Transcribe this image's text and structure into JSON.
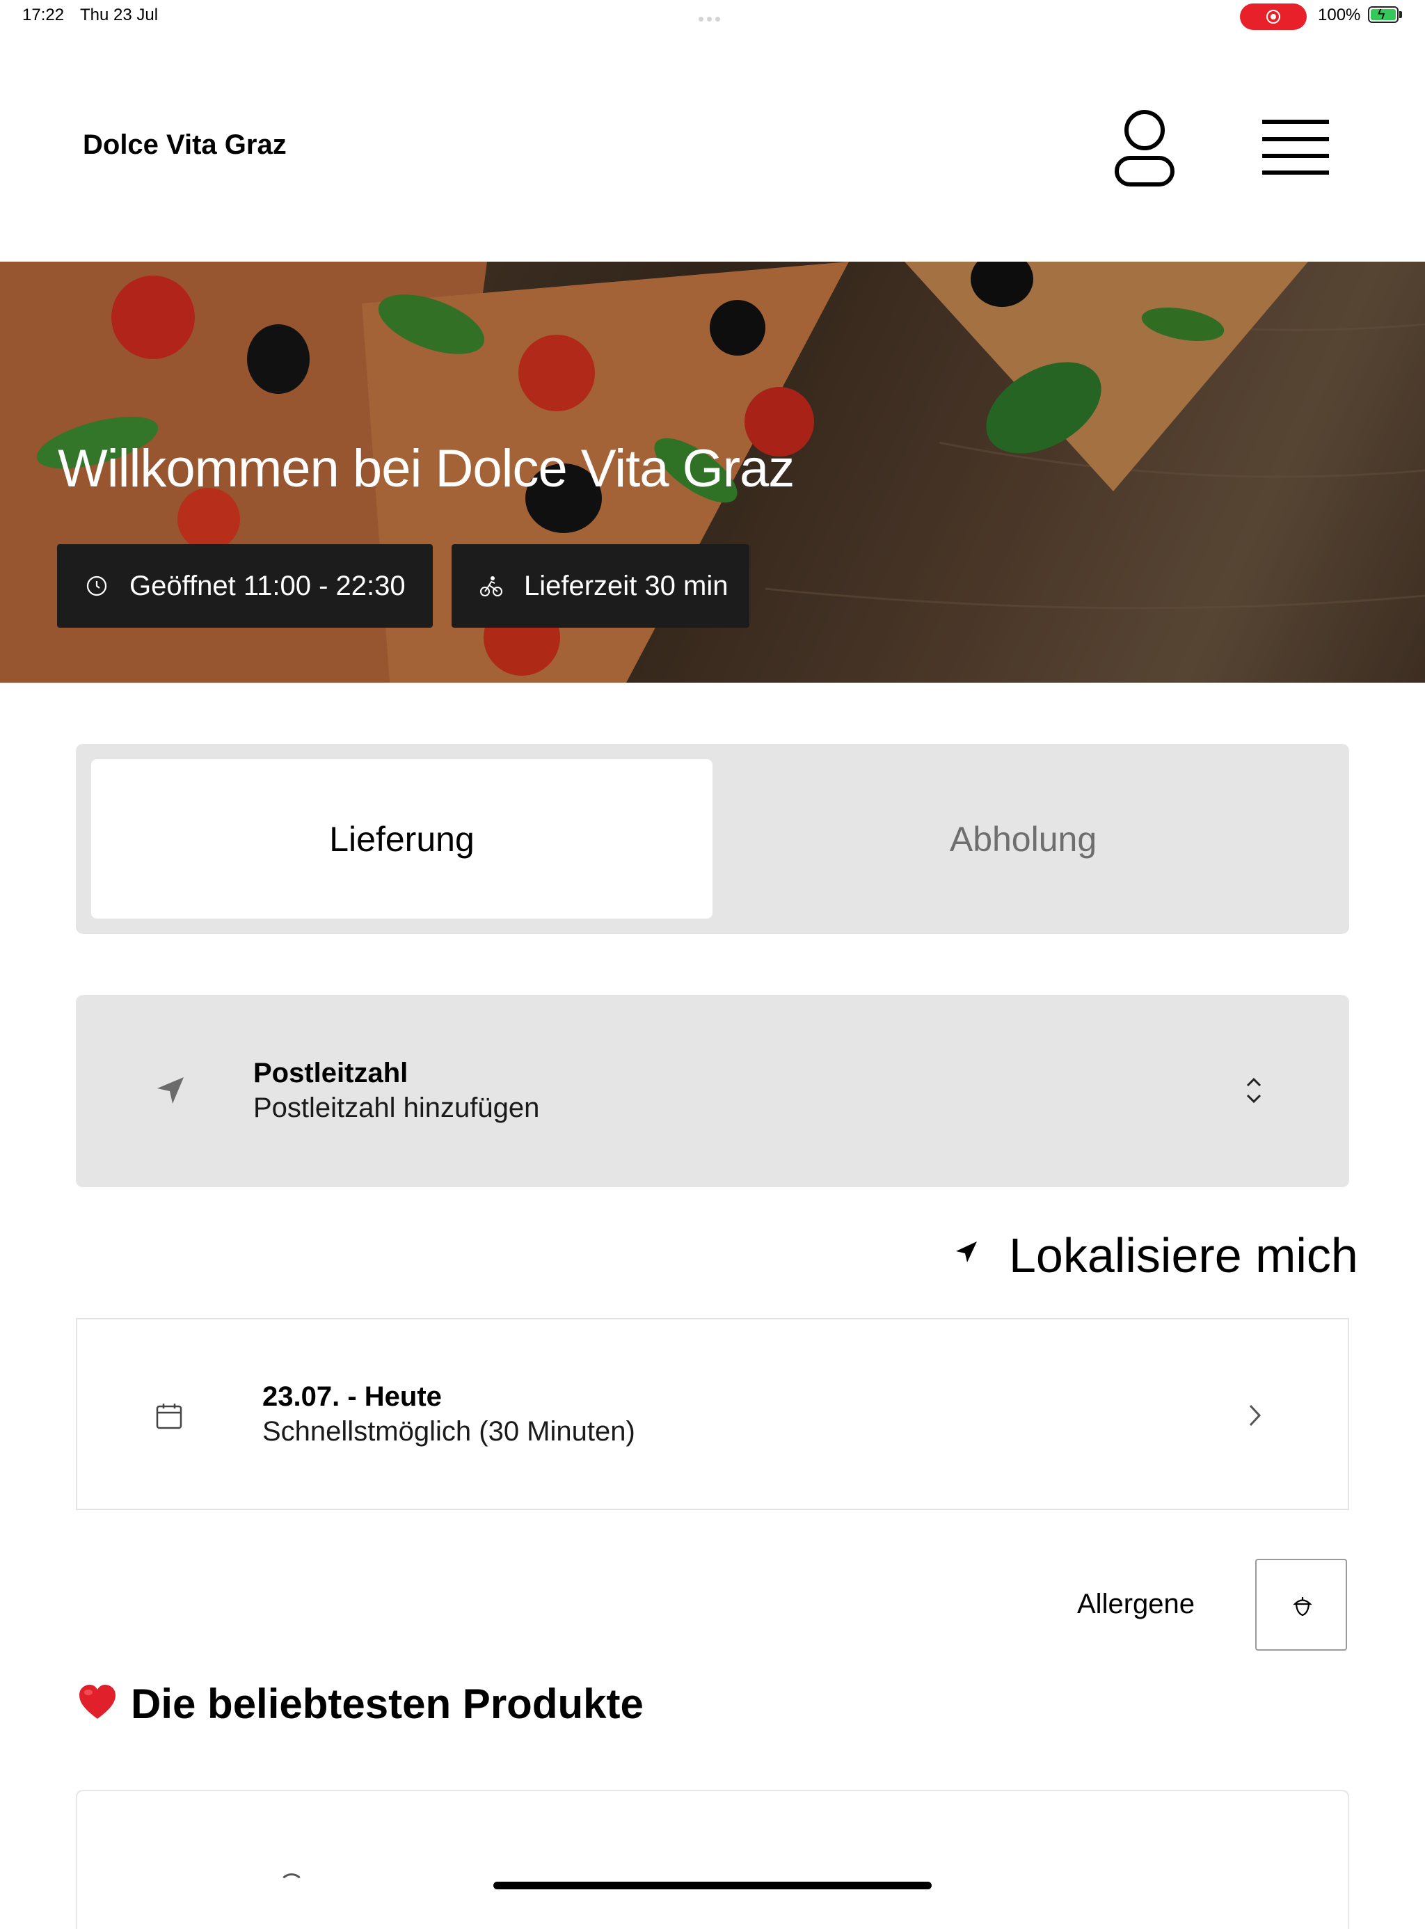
{
  "status_bar": {
    "time": "17:22",
    "date": "Thu 23 Jul",
    "battery": "100%"
  },
  "header": {
    "brand": "Dolce Vita Graz"
  },
  "hero": {
    "title": "Willkommen bei Dolce Vita Graz",
    "opening_hours": "Geöffnet 11:00 - 22:30",
    "delivery_time": "Lieferzeit 30 min"
  },
  "order_mode": {
    "options": [
      "Lieferung",
      "Abholung"
    ],
    "selected": "Lieferung"
  },
  "postal": {
    "label": "Postleitzahl",
    "placeholder": "Postleitzahl hinzufügen"
  },
  "locate": {
    "label": "Lokalisiere mich"
  },
  "delivery_date": {
    "title": "23.07. - Heute",
    "value": "Schnellstmöglich (30 Minuten)"
  },
  "allergens": {
    "label": "Allergene"
  },
  "popular": {
    "title": "Die beliebtesten Produkte"
  },
  "colors": {
    "accent": "#e8202a",
    "panel": "#e5e5e5",
    "chip": "#1c1c1c"
  }
}
